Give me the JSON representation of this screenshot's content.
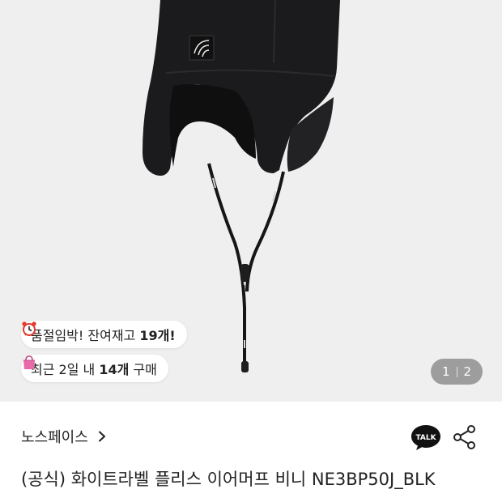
{
  "gallery": {
    "stock_badge": {
      "icon": "alarm-clock-icon",
      "text_prefix": "품절임박! 잔여재고 ",
      "text_bold": "19개!"
    },
    "sold_badge": {
      "icon": "shopping-bag-icon",
      "text_prefix": "최근 2일 내 ",
      "text_bold": "14개",
      "text_suffix": " 구매"
    },
    "pager": {
      "current": "1",
      "total": "2"
    }
  },
  "product": {
    "brand": "노스페이스",
    "title": "(공식) 화이트라벨 플리스 이어머프 비니 NE3BP50J_BLK"
  },
  "actions": {
    "talk_label": "TALK",
    "talk_icon": "kakao-talk-icon",
    "share_icon": "share-icon"
  },
  "colors": {
    "accent_yellow": "#f6d64a",
    "gallery_bg": "#efefef",
    "bag_pink": "#e86aa8"
  }
}
